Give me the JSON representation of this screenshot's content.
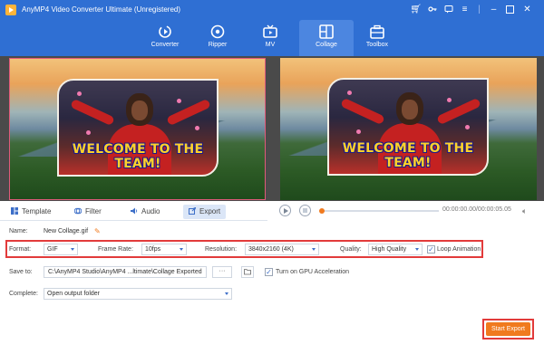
{
  "app": {
    "title": "AnyMP4 Video Converter Ultimate (Unregistered)"
  },
  "nav": {
    "tabs": [
      {
        "label": "Converter",
        "icon": "converter-icon"
      },
      {
        "label": "Ripper",
        "icon": "ripper-disc-icon"
      },
      {
        "label": "MV",
        "icon": "mv-tv-icon"
      },
      {
        "label": "Collage",
        "icon": "collage-grid-icon",
        "active": true
      },
      {
        "label": "Toolbox",
        "icon": "toolbox-icon"
      }
    ]
  },
  "preview": {
    "overlay_text": "WELCOME TO THE TEAM!"
  },
  "edit_tabs": [
    {
      "label": "Template",
      "icon": "template-icon"
    },
    {
      "label": "Filter",
      "icon": "filter-icon"
    },
    {
      "label": "Audio",
      "icon": "audio-icon"
    },
    {
      "label": "Export",
      "icon": "export-icon",
      "active": true
    }
  ],
  "player": {
    "timecode": "00:00:00.00/00:00:05.05",
    "progress": 0
  },
  "export": {
    "name_label": "Name:",
    "name_value": "New Collage.gif",
    "format_label": "Format:",
    "format_value": "GIF",
    "frame_rate_label": "Frame Rate:",
    "frame_rate_value": "10fps",
    "resolution_label": "Resolution:",
    "resolution_value": "3840x2160 (4K)",
    "quality_label": "Quality:",
    "quality_value": "High Quality",
    "loop_label": "Loop Animation",
    "loop_checked": true,
    "save_to_label": "Save to:",
    "save_to_value": "C:\\AnyMP4 Studio\\AnyMP4 ...ltimate\\Collage Exported",
    "browse_label": "···",
    "gpu_label": "Turn on GPU Acceleration",
    "gpu_checked": true,
    "complete_label": "Complete:",
    "complete_value": "Open output folder",
    "start_label": "Start Export"
  },
  "colors": {
    "header": "#2f6fd3",
    "accent": "#f07a1e",
    "highlight": "#e23b3b"
  }
}
